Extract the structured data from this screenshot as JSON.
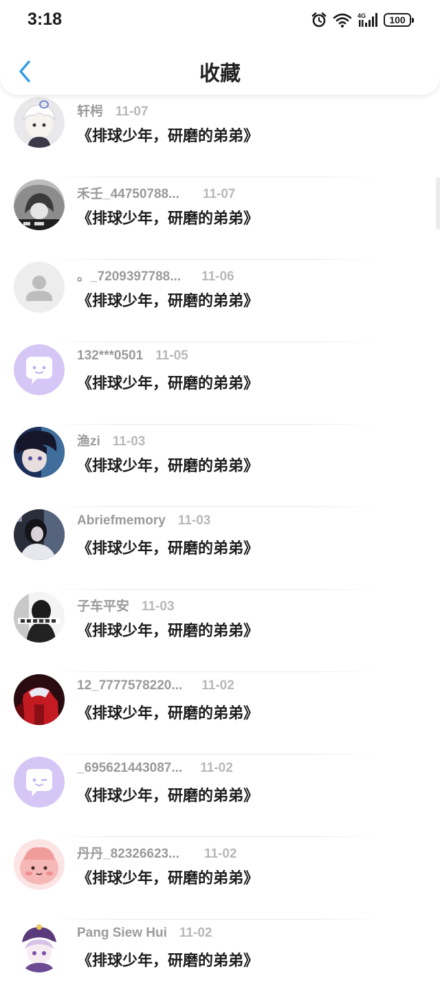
{
  "status_bar": {
    "time": "3:18",
    "network": "4G",
    "battery": "100",
    "icons": [
      "alarm-icon",
      "wifi-icon",
      "signal-icon",
      "battery-icon"
    ]
  },
  "header": {
    "title": "收藏",
    "back_icon": "chevron-left-icon"
  },
  "colors": {
    "accent": "#2f9be8",
    "username": "#9a9a9a",
    "date": "#b8b8b8",
    "title_text": "#1c1c1c"
  },
  "items": [
    {
      "user": "轩枵",
      "date": "11-07",
      "title": "《排球少年，研磨的弟弟》",
      "avatar": "anime-white-hair"
    },
    {
      "user": "禾壬_44750788...",
      "date": "11-07",
      "title": "《排球少年，研磨的弟弟》",
      "avatar": "grayscale-hoodie"
    },
    {
      "user": "。_7209397788...",
      "date": "11-06",
      "title": "《排球少年，研磨的弟弟》",
      "avatar": "default-person"
    },
    {
      "user": "132***0501",
      "date": "11-05",
      "title": "《排球少年，研磨的弟弟》",
      "avatar": "chat-bubble"
    },
    {
      "user": "渔zi",
      "date": "11-03",
      "title": "《排球少年，研磨的弟弟》",
      "avatar": "anime-dark-hair"
    },
    {
      "user": "Abriefmemory",
      "date": "11-03",
      "title": "《排球少年，研磨的弟弟》",
      "avatar": "photo-dark"
    },
    {
      "user": "子车平安",
      "date": "11-03",
      "title": "《排球少年，研磨的弟弟》",
      "avatar": "bw-text-photo"
    },
    {
      "user": "12_7777578220...",
      "date": "11-02",
      "title": "《排球少年，研磨的弟弟》",
      "avatar": "red-character"
    },
    {
      "user": "_695621443087...",
      "date": "11-02",
      "title": "《排球少年，研磨的弟弟》",
      "avatar": "chat-bubble"
    },
    {
      "user": "丹丹_82326623...",
      "date": "11-02",
      "title": "《排球少年，研磨的弟弟》",
      "avatar": "pink-blob"
    },
    {
      "user": "Pang Siew Hui",
      "date": "11-02",
      "title": "《排球少年，研磨的弟弟》",
      "avatar": "anime-purple-hat"
    }
  ]
}
